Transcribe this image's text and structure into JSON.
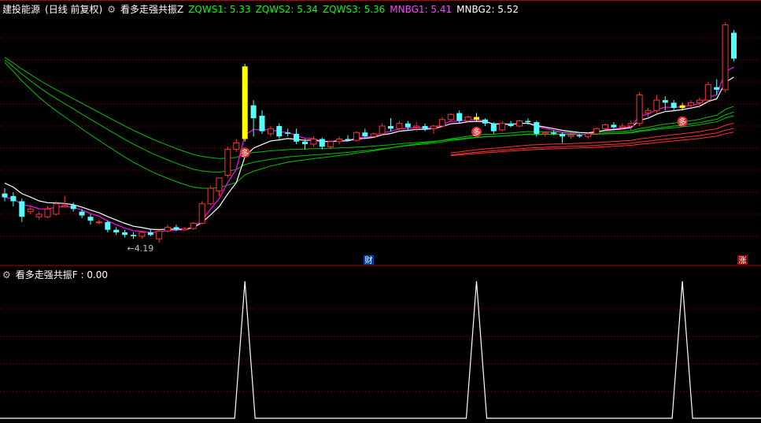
{
  "header": {
    "stock": "建投能源",
    "period": "(日线 前复权)",
    "indicator": "看多走强共振Z",
    "zqws1": "ZQWS1: 5.33",
    "zqws2": "ZQWS2: 5.34",
    "zqws3": "ZQWS3: 5.36",
    "mnbg1": "MNBG1: 5.41",
    "mnbg2": "MNBG2: 5.52"
  },
  "sub_header": {
    "indicator": "看多走强共振F : 0.00"
  },
  "annotations": {
    "low_price": "4.19",
    "caiyuan_mark": "财",
    "zhang_mark": "涨",
    "duo_mark": "多"
  },
  "colors": {
    "up": "#ff3232",
    "down": "#54ffff",
    "signal": "#ffff00",
    "mnbg1": "#ff00ff",
    "mnbg2": "#ffffff",
    "zqws": "#00c000",
    "grid": "#800000"
  },
  "chart_data": {
    "type": "candlestick",
    "price_range": [
      4.1,
      5.85
    ],
    "candles": [
      {
        "o": 4.54,
        "h": 4.58,
        "l": 4.48,
        "c": 4.51
      },
      {
        "o": 4.52,
        "h": 4.55,
        "l": 4.44,
        "c": 4.48
      },
      {
        "o": 4.48,
        "h": 4.5,
        "l": 4.32,
        "c": 4.36
      },
      {
        "o": 4.4,
        "h": 4.44,
        "l": 4.38,
        "c": 4.42
      },
      {
        "o": 4.36,
        "h": 4.4,
        "l": 4.34,
        "c": 4.38
      },
      {
        "o": 4.36,
        "h": 4.44,
        "l": 4.35,
        "c": 4.42
      },
      {
        "o": 4.38,
        "h": 4.48,
        "l": 4.37,
        "c": 4.46
      },
      {
        "o": 4.44,
        "h": 4.52,
        "l": 4.43,
        "c": 4.45
      },
      {
        "o": 4.45,
        "h": 4.47,
        "l": 4.4,
        "c": 4.42
      },
      {
        "o": 4.4,
        "h": 4.42,
        "l": 4.35,
        "c": 4.37
      },
      {
        "o": 4.36,
        "h": 4.38,
        "l": 4.3,
        "c": 4.33
      },
      {
        "o": 4.32,
        "h": 4.34,
        "l": 4.3,
        "c": 4.32
      },
      {
        "o": 4.32,
        "h": 4.33,
        "l": 4.24,
        "c": 4.26
      },
      {
        "o": 4.26,
        "h": 4.28,
        "l": 4.22,
        "c": 4.24
      },
      {
        "o": 4.24,
        "h": 4.26,
        "l": 4.2,
        "c": 4.22
      },
      {
        "o": 4.22,
        "h": 4.24,
        "l": 4.19,
        "c": 4.21
      },
      {
        "o": 4.21,
        "h": 4.25,
        "l": 4.19,
        "c": 4.24
      },
      {
        "o": 4.24,
        "h": 4.26,
        "l": 4.21,
        "c": 4.22
      },
      {
        "o": 4.19,
        "h": 4.26,
        "l": 4.16,
        "c": 4.25
      },
      {
        "o": 4.25,
        "h": 4.3,
        "l": 4.24,
        "c": 4.28
      },
      {
        "o": 4.28,
        "h": 4.3,
        "l": 4.25,
        "c": 4.26
      },
      {
        "o": 4.26,
        "h": 4.28,
        "l": 4.25,
        "c": 4.27
      },
      {
        "o": 4.27,
        "h": 4.32,
        "l": 4.26,
        "c": 4.31
      },
      {
        "o": 4.31,
        "h": 4.48,
        "l": 4.3,
        "c": 4.46
      },
      {
        "o": 4.46,
        "h": 4.6,
        "l": 4.45,
        "c": 4.58
      },
      {
        "o": 4.56,
        "h": 4.66,
        "l": 4.52,
        "c": 4.66
      },
      {
        "o": 4.68,
        "h": 4.9,
        "l": 4.66,
        "c": 4.88
      },
      {
        "o": 4.88,
        "h": 4.96,
        "l": 4.86,
        "c": 4.93
      },
      {
        "o": 4.96,
        "h": 5.54,
        "l": 4.94,
        "c": 5.52
      },
      {
        "o": 5.22,
        "h": 5.26,
        "l": 4.98,
        "c": 5.12
      },
      {
        "o": 5.14,
        "h": 5.18,
        "l": 5.0,
        "c": 5.02
      },
      {
        "o": 5.0,
        "h": 5.06,
        "l": 4.98,
        "c": 5.04
      },
      {
        "o": 5.06,
        "h": 5.08,
        "l": 4.96,
        "c": 4.98
      },
      {
        "o": 5.01,
        "h": 5.04,
        "l": 4.98,
        "c": 5.0
      },
      {
        "o": 5.0,
        "h": 5.04,
        "l": 4.92,
        "c": 4.94
      },
      {
        "o": 4.94,
        "h": 4.96,
        "l": 4.88,
        "c": 4.92
      },
      {
        "o": 4.92,
        "h": 4.98,
        "l": 4.9,
        "c": 4.96
      },
      {
        "o": 4.96,
        "h": 4.97,
        "l": 4.88,
        "c": 4.9
      },
      {
        "o": 4.9,
        "h": 4.95,
        "l": 4.88,
        "c": 4.94
      },
      {
        "o": 4.94,
        "h": 4.98,
        "l": 4.92,
        "c": 4.96
      },
      {
        "o": 4.96,
        "h": 4.99,
        "l": 4.94,
        "c": 4.95
      },
      {
        "o": 4.95,
        "h": 5.02,
        "l": 4.94,
        "c": 5.01
      },
      {
        "o": 5.01,
        "h": 5.04,
        "l": 4.96,
        "c": 4.98
      },
      {
        "o": 4.98,
        "h": 5.01,
        "l": 4.97,
        "c": 5.0
      },
      {
        "o": 5.0,
        "h": 5.08,
        "l": 4.99,
        "c": 5.06
      },
      {
        "o": 5.06,
        "h": 5.12,
        "l": 5.02,
        "c": 5.04
      },
      {
        "o": 5.04,
        "h": 5.1,
        "l": 5.02,
        "c": 5.08
      },
      {
        "o": 5.08,
        "h": 5.1,
        "l": 5.03,
        "c": 5.05
      },
      {
        "o": 5.05,
        "h": 5.09,
        "l": 5.02,
        "c": 5.06
      },
      {
        "o": 5.06,
        "h": 5.08,
        "l": 5.02,
        "c": 5.04
      },
      {
        "o": 5.04,
        "h": 5.07,
        "l": 5.0,
        "c": 5.06
      },
      {
        "o": 5.06,
        "h": 5.13,
        "l": 5.05,
        "c": 5.11
      },
      {
        "o": 5.11,
        "h": 5.16,
        "l": 5.1,
        "c": 5.15
      },
      {
        "o": 5.16,
        "h": 5.18,
        "l": 5.08,
        "c": 5.1
      },
      {
        "o": 5.1,
        "h": 5.14,
        "l": 5.09,
        "c": 5.13
      },
      {
        "o": 5.13,
        "h": 5.16,
        "l": 5.1,
        "c": 5.11
      },
      {
        "o": 5.11,
        "h": 5.12,
        "l": 5.06,
        "c": 5.08
      },
      {
        "o": 5.08,
        "h": 5.09,
        "l": 5.0,
        "c": 5.02
      },
      {
        "o": 5.03,
        "h": 5.1,
        "l": 5.02,
        "c": 5.08
      },
      {
        "o": 5.08,
        "h": 5.1,
        "l": 5.05,
        "c": 5.06
      },
      {
        "o": 5.06,
        "h": 5.11,
        "l": 5.05,
        "c": 5.1
      },
      {
        "o": 5.1,
        "h": 5.12,
        "l": 5.07,
        "c": 5.09
      },
      {
        "o": 5.09,
        "h": 5.1,
        "l": 4.98,
        "c": 5.0
      },
      {
        "o": 5.0,
        "h": 5.02,
        "l": 4.98,
        "c": 5.01
      },
      {
        "o": 5.01,
        "h": 5.03,
        "l": 4.99,
        "c": 5.0
      },
      {
        "o": 5.0,
        "h": 5.01,
        "l": 4.93,
        "c": 4.98
      },
      {
        "o": 4.98,
        "h": 5.01,
        "l": 4.96,
        "c": 4.99
      },
      {
        "o": 4.99,
        "h": 5.0,
        "l": 4.97,
        "c": 4.98
      },
      {
        "o": 4.98,
        "h": 5.01,
        "l": 4.96,
        "c": 5.0
      },
      {
        "o": 5.0,
        "h": 5.05,
        "l": 4.99,
        "c": 5.04
      },
      {
        "o": 5.04,
        "h": 5.08,
        "l": 5.03,
        "c": 5.07
      },
      {
        "o": 5.07,
        "h": 5.09,
        "l": 5.04,
        "c": 5.05
      },
      {
        "o": 5.05,
        "h": 5.08,
        "l": 5.04,
        "c": 5.06
      },
      {
        "o": 5.06,
        "h": 5.1,
        "l": 5.02,
        "c": 5.08
      },
      {
        "o": 5.08,
        "h": 5.32,
        "l": 5.06,
        "c": 5.3
      },
      {
        "o": 5.16,
        "h": 5.2,
        "l": 5.12,
        "c": 5.18
      },
      {
        "o": 5.18,
        "h": 5.3,
        "l": 5.16,
        "c": 5.26
      },
      {
        "o": 5.26,
        "h": 5.29,
        "l": 5.18,
        "c": 5.24
      },
      {
        "o": 5.24,
        "h": 5.26,
        "l": 5.18,
        "c": 5.2
      },
      {
        "o": 5.2,
        "h": 5.24,
        "l": 5.18,
        "c": 5.22
      },
      {
        "o": 5.22,
        "h": 5.26,
        "l": 5.2,
        "c": 5.24
      },
      {
        "o": 5.24,
        "h": 5.28,
        "l": 5.2,
        "c": 5.26
      },
      {
        "o": 5.26,
        "h": 5.4,
        "l": 5.24,
        "c": 5.38
      },
      {
        "o": 5.36,
        "h": 5.42,
        "l": 5.3,
        "c": 5.34
      },
      {
        "o": 5.34,
        "h": 5.86,
        "l": 5.32,
        "c": 5.84
      },
      {
        "o": 5.78,
        "h": 5.8,
        "l": 5.56,
        "c": 5.58
      }
    ],
    "signal_bars": [
      28,
      55,
      79
    ],
    "sub_signal": [
      28,
      55,
      79
    ],
    "sub_value": 0.0
  }
}
